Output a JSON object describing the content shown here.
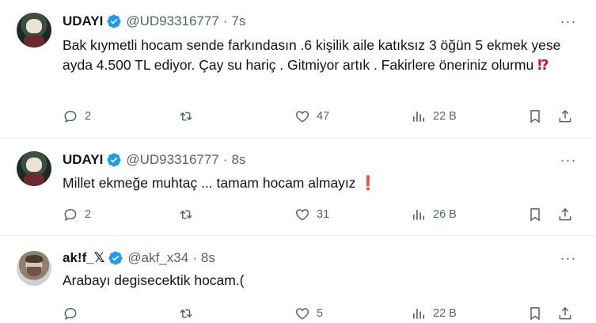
{
  "tweets": [
    {
      "name": "UDAYI",
      "handle": "@UD93316777",
      "separator": "·",
      "time": "7s",
      "text": "Bak kıymetli hocam sende farkındasın .6 kişilik aile katıksız 3 öğün 5 ekmek yese ayda 4.500 TL ediyor. Çay su hariç . Gitmiyor artık . Fakirlere öneriniz olurmu",
      "emoji": "⁉",
      "replies": "2",
      "likes": "47",
      "views": "22 B",
      "more": "···"
    },
    {
      "name": "UDAYI",
      "handle": "@UD93316777",
      "separator": "·",
      "time": "8s",
      "text": "Millet ekmeğe muhtaç ... tamam hocam almayız",
      "emoji": "❗",
      "replies": "2",
      "likes": "31",
      "views": "26 B",
      "more": "···"
    },
    {
      "name": "ak!f_𝕏",
      "handle": "@akf_x34",
      "separator": "·",
      "time": "8s",
      "text": "Arabayı degisecektik hocam.(",
      "replies": "",
      "likes": "5",
      "views": "22 B",
      "more": "···"
    }
  ],
  "colors": {
    "verified": "#1d9bf0",
    "muted": "#536471",
    "text": "#0f1419",
    "divider": "#eff3f4"
  }
}
